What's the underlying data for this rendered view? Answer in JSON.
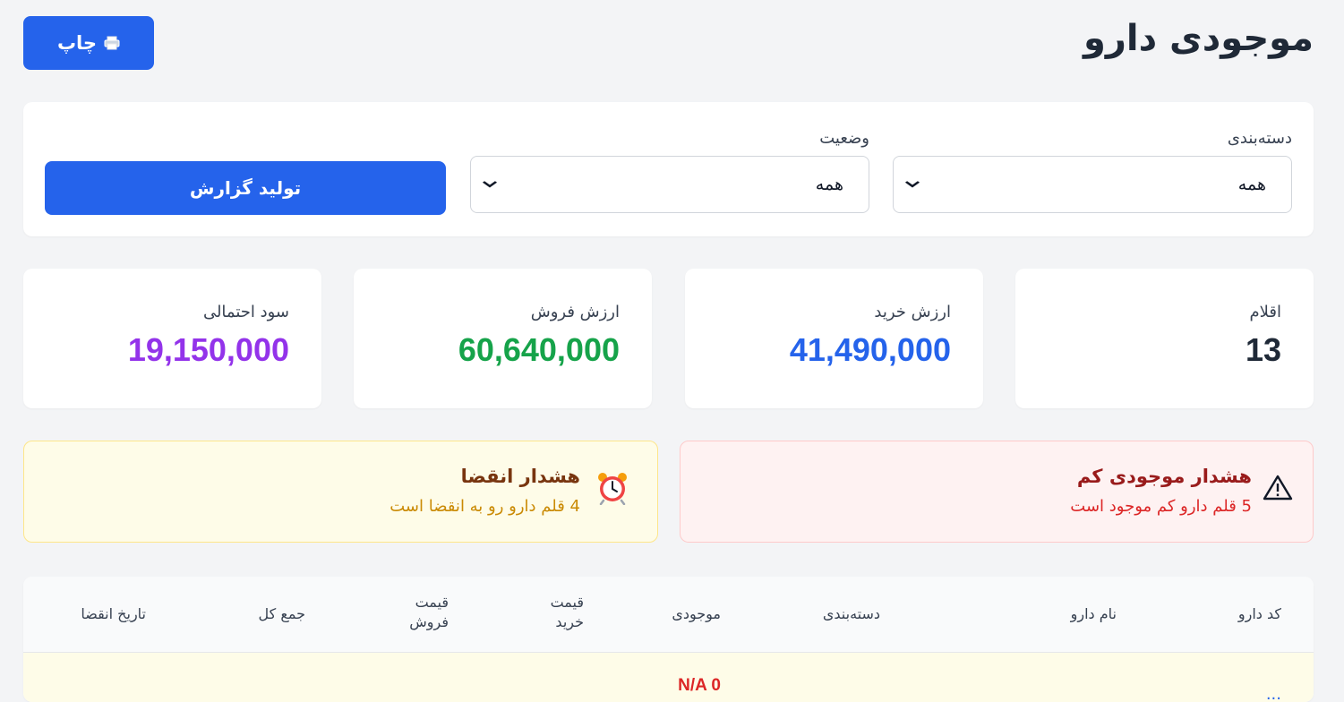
{
  "header": {
    "title": "موجودی دارو",
    "print_label": "چاپ",
    "print_icon": "printer-icon"
  },
  "filters": {
    "category_label": "دسته‌بندی",
    "category_value": "همه",
    "status_label": "وضعیت",
    "status_value": "همه",
    "generate_label": "تولید گزارش"
  },
  "stats": [
    {
      "label": "اقلام",
      "value": "13",
      "color": "#1f2937"
    },
    {
      "label": "ارزش خرید",
      "value": "41,490,000",
      "color": "#2563eb"
    },
    {
      "label": "ارزش فروش",
      "value": "60,640,000",
      "color": "#16a34a"
    },
    {
      "label": "سود احتمالی",
      "value": "19,150,000",
      "color": "#9333ea"
    }
  ],
  "alerts": {
    "low_stock": {
      "title": "هشدار موجودی کم",
      "text": "5 قلم دارو کم موجود است",
      "icon": "warning-icon"
    },
    "expiry": {
      "title": "هشدار انقضا",
      "text": "4 قلم دارو رو به انقضا است",
      "icon": "alarm-clock-icon"
    }
  },
  "table": {
    "columns": [
      "کد دارو",
      "نام دارو",
      "دسته‌بندی",
      "موجودی",
      "قیمت خرید",
      "قیمت فروش",
      "جمع کل",
      "تاریخ انقضا"
    ],
    "rows": [
      {
        "code": "...",
        "stock": "N/A 0"
      }
    ]
  },
  "colors": {
    "primary": "#2563eb",
    "danger": "#dc2626",
    "warning_bg": "#fefce8",
    "danger_bg": "#fef2f2"
  }
}
